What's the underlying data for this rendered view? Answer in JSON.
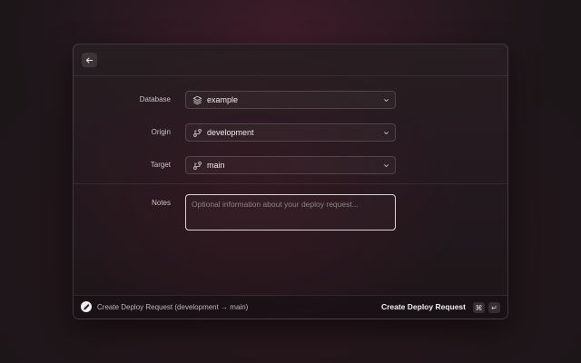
{
  "form": {
    "database": {
      "label": "Database",
      "value": "example",
      "icon": "layers-icon"
    },
    "origin": {
      "label": "Origin",
      "value": "development",
      "icon": "branch-icon"
    },
    "target": {
      "label": "Target",
      "value": "main",
      "icon": "branch-icon"
    },
    "notes": {
      "label": "Notes",
      "placeholder": "Optional information about your deploy request..."
    }
  },
  "footer": {
    "summary": "Create Deploy Request (development → main)",
    "action_label": "Create Deploy Request",
    "shortcut_cmd": "⌘",
    "shortcut_enter": "↵"
  }
}
